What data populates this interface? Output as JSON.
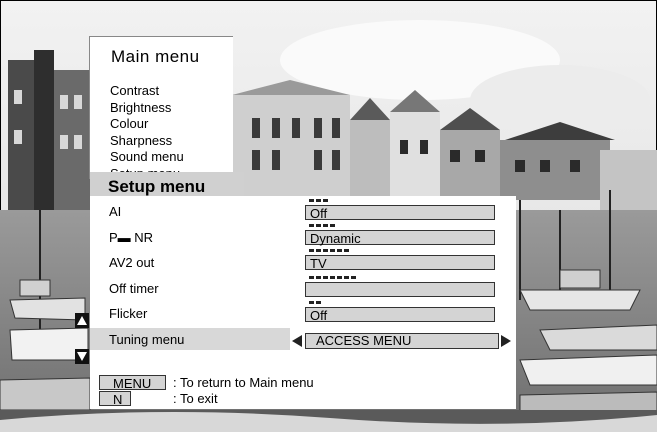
{
  "main_menu": {
    "title": "Main menu",
    "items": [
      "Contrast",
      "Brightness",
      "Colour",
      "Sharpness",
      "Sound menu",
      "Setup menu"
    ]
  },
  "setup_menu": {
    "title": "Setup menu",
    "rows": [
      {
        "label": "AI",
        "value": "Off"
      },
      {
        "label": "P▬ NR",
        "value": "Dynamic"
      },
      {
        "label": "AV2 out",
        "value": "TV"
      },
      {
        "label": "Off timer",
        "value": ""
      },
      {
        "label": "Flicker",
        "value": "Off"
      }
    ],
    "tuning": {
      "label": "Tuning menu",
      "value": "ACCESS MENU"
    }
  },
  "help": {
    "menu_key": "MENU",
    "menu_text": ": To return to Main menu",
    "exit_key": "N",
    "exit_text": ": To exit"
  },
  "icons": {
    "scroll_up": "up-triangle-icon",
    "scroll_down": "down-triangle-icon",
    "prev": "left-triangle-icon",
    "next": "right-triangle-icon"
  }
}
